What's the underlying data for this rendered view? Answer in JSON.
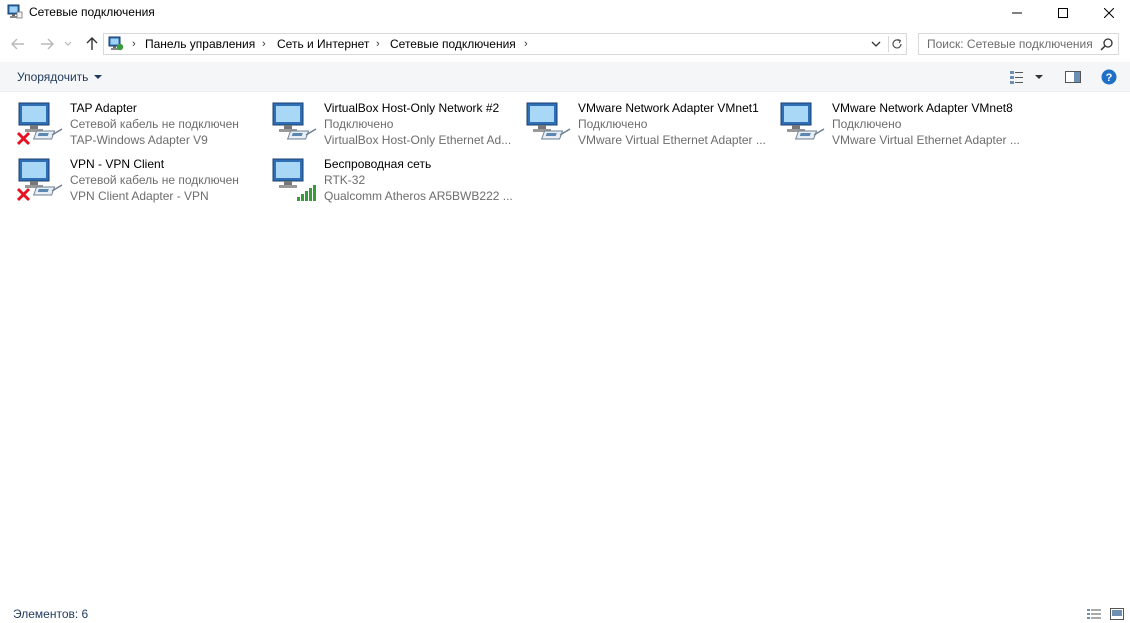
{
  "window": {
    "title": "Сетевые подключения",
    "controls": {
      "minimize": "minimize-icon",
      "maximize": "maximize-icon",
      "close": "close-icon"
    }
  },
  "address": {
    "breadcrumbs": [
      "Панель управления",
      "Сеть и Интернет",
      "Сетевые подключения"
    ],
    "search_placeholder": "Поиск: Сетевые подключения"
  },
  "commandbar": {
    "organize_label": "Упорядочить"
  },
  "connections": [
    {
      "name": "TAP Adapter",
      "status": "Сетевой кабель не подключен",
      "device": "TAP-Windows Adapter V9",
      "state": "disconnected"
    },
    {
      "name": "VirtualBox Host-Only Network #2",
      "status": "Подключено",
      "device": "VirtualBox Host-Only Ethernet Ad...",
      "state": "connected"
    },
    {
      "name": "VMware Network Adapter VMnet1",
      "status": "Подключено",
      "device": "VMware Virtual Ethernet Adapter ...",
      "state": "connected"
    },
    {
      "name": "VMware Network Adapter VMnet8",
      "status": "Подключено",
      "device": "VMware Virtual Ethernet Adapter ...",
      "state": "connected"
    },
    {
      "name": "VPN - VPN Client",
      "status": "Сетевой кабель не подключен",
      "device": "VPN Client Adapter - VPN",
      "state": "disconnected"
    },
    {
      "name": "Беспроводная сеть",
      "status": "RTK-32",
      "device": "Qualcomm Atheros AR5BWB222 ...",
      "state": "wireless"
    }
  ],
  "statusbar": {
    "count_label": "Элементов: 6"
  },
  "colors": {
    "accent_text": "#1e395b",
    "muted_text": "#6d6d6d",
    "error_red": "#e81123",
    "signal_green": "#3a9b3a",
    "help_blue": "#1e6fc8"
  }
}
